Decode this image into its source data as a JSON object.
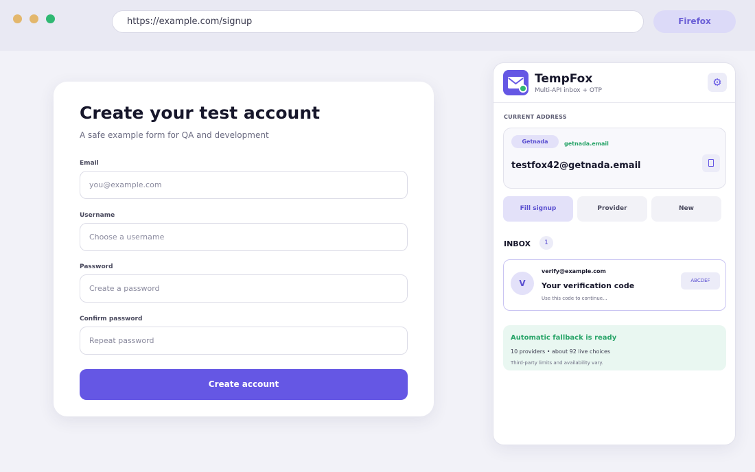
{
  "browser": {
    "url": "https://example.com/signup",
    "button_label": "Firefox"
  },
  "signup": {
    "title": "Create your test account",
    "subtitle": "A safe example form for QA and development",
    "fields": [
      {
        "label": "Email",
        "placeholder": "you@example.com"
      },
      {
        "label": "Username",
        "placeholder": "Choose a username"
      },
      {
        "label": "Password",
        "placeholder": "Create a password"
      },
      {
        "label": "Confirm password",
        "placeholder": "Repeat password"
      }
    ],
    "submit_label": "Create account"
  },
  "extension": {
    "name": "TempFox",
    "tagline": "Multi-API inbox + OTP",
    "settings_icon": "gear-icon",
    "current_address_label": "CURRENT ADDRESS",
    "provider": "Getnada",
    "provider_domain": "getnada.email",
    "address": "testfox42@getnada.email",
    "actions": [
      "Fill signup",
      "Provider",
      "New"
    ],
    "inbox_label": "INBOX",
    "inbox_count": "1",
    "messages": [
      {
        "avatar": "V",
        "from": "verify@example.com",
        "subject": "Your verification code",
        "preview": "Use this code to continue...",
        "otp": "ABCDEF"
      }
    ],
    "fallback": {
      "title": "Automatic fallback is ready",
      "summary": "10 providers • about 92 live choices",
      "note": "Third-party limits and availability vary."
    }
  },
  "colors": {
    "accent": "#6557e4",
    "success": "#28a468",
    "page_bg": "#f2f2f8"
  }
}
